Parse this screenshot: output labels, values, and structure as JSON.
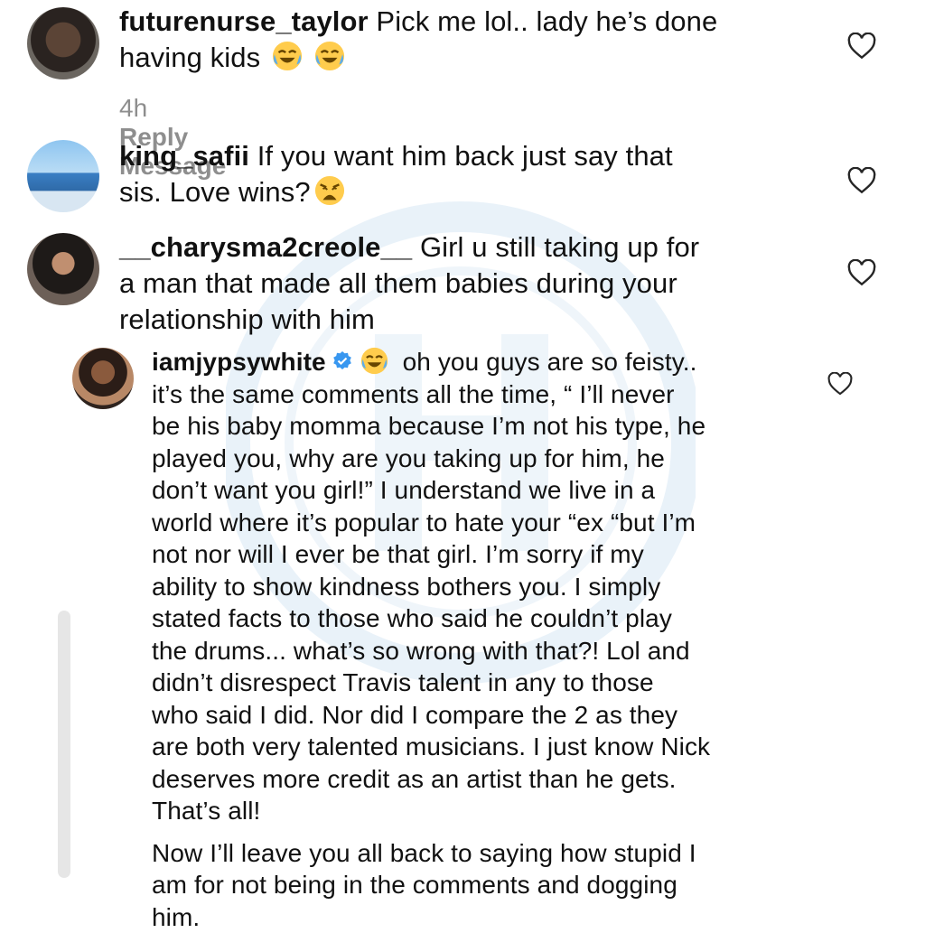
{
  "comments": [
    {
      "username": "futurenurse_taylor",
      "text": "Pick me lol.. lady he’s done",
      "text_line2": "having kids",
      "emoji": [
        "tears-of-joy-emoji",
        "tears-of-joy-emoji"
      ],
      "time": "4h",
      "reply_label": "Reply",
      "message_label": "Message"
    },
    {
      "username": "king_safii",
      "text": "If you want him back just say that",
      "text_line2": "sis. Love wins?",
      "emoji": [
        "weary-face-emoji"
      ]
    },
    {
      "username": "__charysma2creole__",
      "text_lines": [
        "Girl u still taking up for",
        "a man that made all them babies during your",
        "relationship with him"
      ]
    }
  ],
  "reply": {
    "username": "iamjypsywhite",
    "verified": true,
    "lines": [
      "oh you guys are so feisty..",
      "it’s the same comments all the time, “ I’ll never",
      "be his baby momma because I’m not his type, he",
      "played you, why are you taking up for him, he",
      "don’t want you girl!” I understand we live in a",
      "world where it’s popular to hate your “ex “but I’m",
      "not nor will I ever be that girl. I’m sorry if my",
      "ability to show kindness bothers you. I simply",
      "stated facts to those who said he couldn’t play",
      "the drums... what’s so wrong with that?! Lol and",
      "didn’t disrespect Travis talent in any to those",
      "who said I did. Nor did I compare the 2 as they",
      "are both very talented musicians. I just know Nick",
      "deserves more credit as an artist than he gets.",
      "That’s all!"
    ],
    "lines2": [
      "Now I’ll leave you all back to saying how stupid I",
      "am for not being in the comments and dogging",
      "him."
    ]
  },
  "colors": {
    "text": "#111111",
    "meta": "#8e8e8e",
    "verified": "#3897f0",
    "heart": "#262626",
    "watermark": "#e8f1f8"
  },
  "icons": {
    "like": "heart-outline-icon",
    "verified": "verified-badge-icon"
  }
}
